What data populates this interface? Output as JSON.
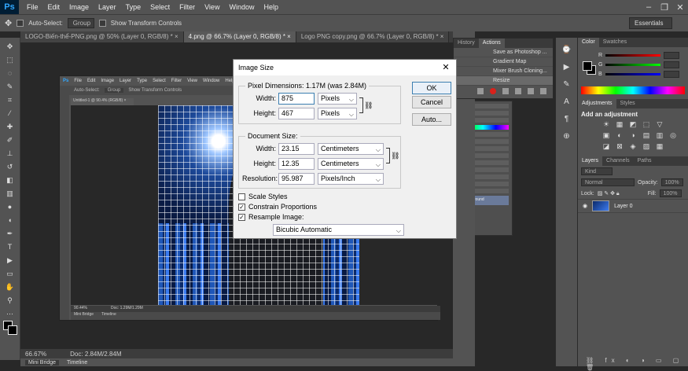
{
  "menubar": {
    "logo": "Ps",
    "items": [
      "File",
      "Edit",
      "Image",
      "Layer",
      "Type",
      "Select",
      "Filter",
      "View",
      "Window",
      "Help"
    ],
    "win_controls": [
      "–",
      "❐",
      "✕"
    ]
  },
  "optbar": {
    "auto_select": "Auto-Select:",
    "group": "Group",
    "show_transform": "Show Transform Controls",
    "workspace": "Essentials"
  },
  "tabs": [
    {
      "label": "LOGO-Biến-thể-PNG.png @ 50% (Layer 0, RGB/8) *  ×",
      "active": false
    },
    {
      "label": "4.png @ 66.7% (Layer 0, RGB/8) *  ×",
      "active": true
    },
    {
      "label": "Logo PNG copy.png @ 66.7% (Layer 0, RGB/8) *  ×",
      "active": false
    }
  ],
  "status": {
    "zoom": "66.67%",
    "doc": "Doc: 2.84M/2.84M"
  },
  "bottom_tabs": [
    "Mini Bridge",
    "Timeline"
  ],
  "inner": {
    "menu": [
      "File",
      "Edit",
      "Image",
      "Layer",
      "Type",
      "Select",
      "Filter",
      "View",
      "Window",
      "Help"
    ],
    "opt": [
      "Auto-Select:",
      "Group",
      "Show Transform Controls"
    ],
    "tab": "Untitled-1 @ 90.4% (RGB/8) ×",
    "zoom": "90.44%",
    "doc": "Doc: 1.29M/1.29M",
    "bottom_tabs": [
      "Mini Bridge",
      "Timeline"
    ],
    "layer": "Background"
  },
  "history_panel": {
    "tabs": [
      "History",
      "Actions"
    ],
    "actions": [
      {
        "label": "Save as Photoshop ...",
        "selected": false
      },
      {
        "label": "Gradient Map",
        "selected": false
      },
      {
        "label": "Mixer Brush Cloning...",
        "selected": false
      },
      {
        "label": "Resize",
        "selected": true
      }
    ]
  },
  "color_panel": {
    "tabs": [
      "Color",
      "Swatches"
    ],
    "channels": [
      {
        "name": "R",
        "color": "#ff0000"
      },
      {
        "name": "G",
        "color": "#00ff00"
      },
      {
        "name": "B",
        "color": "#0000ff"
      }
    ]
  },
  "adjustments_panel": {
    "tabs": [
      "Adjustments",
      "Styles"
    ],
    "title": "Add an adjustment",
    "icons": [
      "☀",
      "▦",
      "◩",
      "⬚",
      "▽",
      "",
      "",
      "",
      "▣",
      "◐",
      "◑",
      "▤",
      "▥",
      "◎",
      "",
      "",
      "◪",
      "⊠",
      "◈",
      "▨",
      "▦",
      "",
      "",
      ""
    ]
  },
  "layers_panel": {
    "tabs": [
      "Layers",
      "Channels",
      "Paths"
    ],
    "kind": "Kind",
    "blend": "Normal",
    "opacity_label": "Opacity:",
    "opacity": "100%",
    "lock_label": "Lock:",
    "fill_label": "Fill:",
    "fill": "100%",
    "layer_name": "Layer 0"
  },
  "dialog": {
    "title": "Image Size",
    "close": "✕",
    "pixel_dimensions_label": "Pixel Dimensions:  1.17M (was 2.84M)",
    "width_label": "Width:",
    "width_value": "875",
    "width_unit": "Pixels",
    "height_label": "Height:",
    "height_value": "467",
    "height_unit": "Pixels",
    "document_size_label": "Document Size:",
    "doc_width_label": "Width:",
    "doc_width_value": "23.15",
    "doc_width_unit": "Centimeters",
    "doc_height_label": "Height:",
    "doc_height_value": "12.35",
    "doc_height_unit": "Centimeters",
    "resolution_label": "Resolution:",
    "resolution_value": "95.987",
    "resolution_unit": "Pixels/Inch",
    "scale_styles": "Scale Styles",
    "scale_styles_checked": false,
    "constrain": "Constrain Proportions",
    "constrain_checked": true,
    "resample": "Resample Image:",
    "resample_checked": true,
    "resample_method": "Bicubic Automatic",
    "ok": "OK",
    "cancel": "Cancel",
    "auto": "Auto..."
  }
}
